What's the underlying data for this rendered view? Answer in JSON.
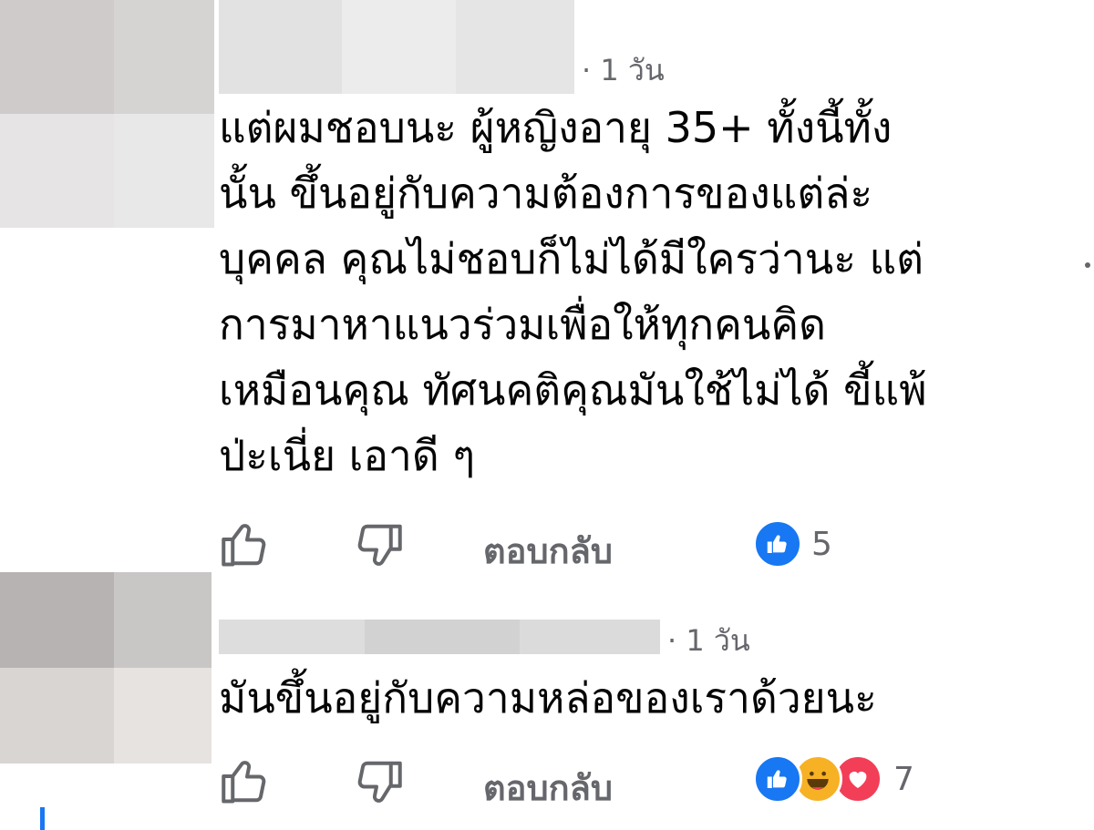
{
  "comments": [
    {
      "time": "· 1 วัน",
      "lines": [
        "แต่ผมชอบนะ ผู้หญิงอายุ 35+ ทั้งนี้ทั้ง",
        "นั้น ขึ้นอยู่กับความต้องการของแต่ล่ะ",
        "บุคคล คุณไม่ชอบก็ไม่ได้มีใครว่านะ แต่",
        "การมาหาแนวร่วมเพื่อให้ทุกคนคิด",
        "เหมือนคุณ ทัศนคติคุณมันใช้ไม่ได้ ขี้แพ้",
        "ป่ะเนี่ย เอาดี ๆ"
      ],
      "reply_label": "ตอบกลับ",
      "reaction_count": "5",
      "reactions": [
        "like-icon"
      ]
    },
    {
      "time": "· 1 วัน",
      "lines": [
        "มันขึ้นอยู่กับความหล่อของเราด้วยนะ"
      ],
      "reply_label": "ตอบกลับ",
      "reaction_count": "7",
      "reactions": [
        "like-icon",
        "haha-icon",
        "love-icon"
      ]
    }
  ],
  "colors": {
    "like_blue": "#1877f2",
    "haha_yellow": "#f7b125",
    "love_red": "#f33e58",
    "muted_text": "#65676b"
  }
}
